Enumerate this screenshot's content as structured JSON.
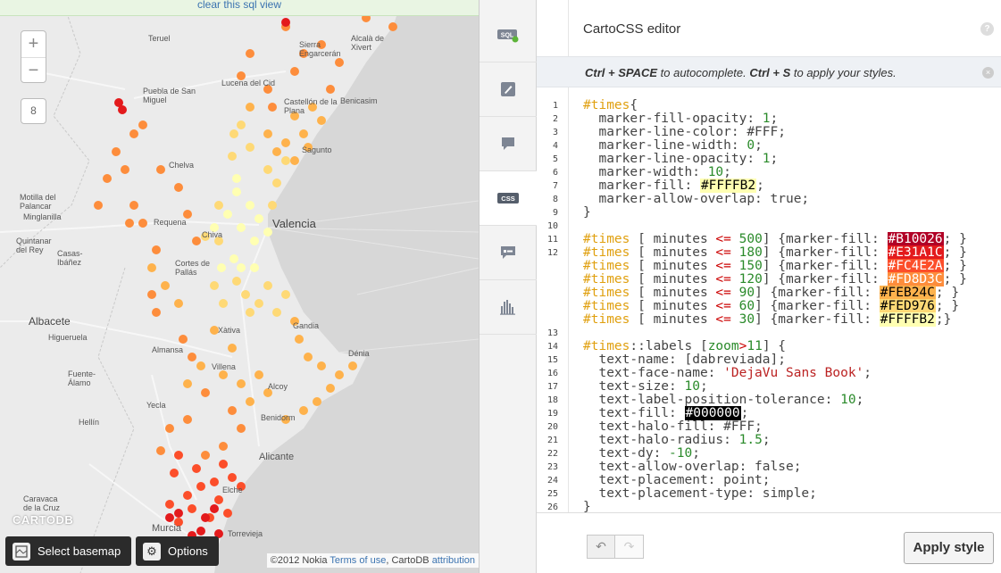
{
  "map": {
    "sql_banner": "clear this sql view",
    "zoom_in": "+",
    "zoom_out": "−",
    "zoom_level": "8",
    "logo": "CARTODB",
    "basemap_button": "Select basemap",
    "options_button": "Options",
    "attribution": {
      "prefix": "©2012 Nokia",
      "terms": "Terms of use",
      "middle": ", CartoDB",
      "link": "attribution"
    },
    "labels": {
      "l1": "Teruel",
      "l2": "Sierra Engarcerán",
      "l3": "Puebla de San Miguel",
      "l4": "Lucena del Cid",
      "l5": "Castellón de la Plana",
      "l6": "Benicasim",
      "l7": "Chelva",
      "l8": "Requena",
      "l9": "Valencia",
      "l10": "Motilla del Palancar",
      "l11": "Minglanilla",
      "l12": "Quintanar del Rey",
      "l13": "Casas-Ibáñez",
      "l14": "Albacete",
      "l15": "Higueruela",
      "l16": "Almansa",
      "l17": "Fuente-Álamo",
      "l18": "Hellín",
      "l19": "Yecla",
      "l20": "Gandia",
      "l21": "Dénia",
      "l22": "Alicante",
      "l23": "Murcia",
      "l24": "Torrevieja",
      "l25": "Caravaca de la Cruz",
      "l26": "Alcalà de Xivert",
      "l27": "Cortes de Pallás",
      "l28": "Alcoy",
      "l29": "Benidorm",
      "l30": "Elche",
      "l31": "Sagunto",
      "l32": "Chiva",
      "l33": "Xàtiva",
      "l34": "Villena"
    }
  },
  "toolbar": {
    "items": [
      {
        "name": "sql-tool",
        "label": "SQL"
      },
      {
        "name": "wizard-tool",
        "label": "wizard"
      },
      {
        "name": "infowindow-tool",
        "label": "infowindow"
      },
      {
        "name": "css-tool",
        "label": "CSS"
      },
      {
        "name": "legend-tool",
        "label": "legend"
      },
      {
        "name": "filters-tool",
        "label": "filters"
      }
    ]
  },
  "editor": {
    "title": "CartoCSS editor",
    "help": "?",
    "hint": {
      "k1": "Ctrl + SPACE",
      "t1": " to autocomplete. ",
      "k2": "Ctrl + S",
      "t2": " to apply your styles."
    },
    "close": "×",
    "undo": "↶",
    "redo": "↷",
    "apply_button": "Apply style",
    "code_lines": [
      {
        "n": "1",
        "tokens": [
          [
            "sel",
            "#times"
          ],
          [
            "",
            "{"
          ]
        ]
      },
      {
        "n": "2",
        "tokens": [
          [
            "",
            "  marker-fill-opacity: "
          ],
          [
            "num",
            "1"
          ],
          [
            "",
            ";"
          ]
        ]
      },
      {
        "n": "3",
        "tokens": [
          [
            "",
            "  marker-line-color: #FFF;"
          ]
        ]
      },
      {
        "n": "4",
        "tokens": [
          [
            "",
            "  marker-line-width: "
          ],
          [
            "num",
            "0"
          ],
          [
            "",
            ";"
          ]
        ]
      },
      {
        "n": "5",
        "tokens": [
          [
            "",
            "  marker-line-opacity: "
          ],
          [
            "num",
            "1"
          ],
          [
            "",
            ";"
          ]
        ]
      },
      {
        "n": "6",
        "tokens": [
          [
            "",
            "  marker-width: "
          ],
          [
            "num",
            "10"
          ],
          [
            "",
            ";"
          ]
        ]
      },
      {
        "n": "7",
        "tokens": [
          [
            "",
            "  marker-fill: "
          ],
          [
            "sw:#FFFFB2:#000",
            "#FFFFB2"
          ],
          [
            "",
            ";"
          ]
        ]
      },
      {
        "n": "8",
        "tokens": [
          [
            "",
            "  marker-allow-overlap: true;"
          ]
        ]
      },
      {
        "n": "9",
        "tokens": [
          [
            "",
            "}"
          ]
        ]
      },
      {
        "n": "10",
        "tokens": []
      },
      {
        "n": "11",
        "tokens": [
          [
            "sel",
            "#times"
          ],
          [
            "",
            " [ minutes "
          ],
          [
            "op",
            "<="
          ],
          [
            "num",
            " 500"
          ],
          [
            "",
            "] {marker-fill: "
          ],
          [
            "sw:#B10026:#fff",
            "#B10026"
          ],
          [
            "",
            "; }"
          ]
        ]
      },
      {
        "n": "12",
        "tokens": [
          [
            "sel",
            "#times"
          ],
          [
            "",
            " [ minutes "
          ],
          [
            "op",
            "<="
          ],
          [
            "num",
            " 180"
          ],
          [
            "",
            "] {marker-fill: "
          ],
          [
            "sw:#E31A1C:#fff",
            "#E31A1C"
          ],
          [
            "",
            "; }"
          ]
        ]
      },
      {
        "n": "",
        "tokens": [
          [
            "sel",
            "#times"
          ],
          [
            "",
            " [ minutes "
          ],
          [
            "op",
            "<="
          ],
          [
            "num",
            " 150"
          ],
          [
            "",
            "] {marker-fill: "
          ],
          [
            "sw:#FC4E2A:#fff",
            "#FC4E2A"
          ],
          [
            "",
            "; }"
          ]
        ]
      },
      {
        "n": "",
        "tokens": [
          [
            "sel",
            "#times"
          ],
          [
            "",
            " [ minutes "
          ],
          [
            "op",
            "<="
          ],
          [
            "num",
            " 120"
          ],
          [
            "",
            "] {marker-fill: "
          ],
          [
            "sw:#FD8D3C:#fff",
            "#FD8D3C"
          ],
          [
            "",
            "; }"
          ]
        ]
      },
      {
        "n": "",
        "tokens": [
          [
            "sel",
            "#times"
          ],
          [
            "",
            " [ minutes "
          ],
          [
            "op",
            "<="
          ],
          [
            "num",
            " 90"
          ],
          [
            "",
            "] {marker-fill: "
          ],
          [
            "sw:#FEB24C:#000",
            "#FEB24C"
          ],
          [
            "",
            "; }"
          ]
        ]
      },
      {
        "n": "",
        "tokens": [
          [
            "sel",
            "#times"
          ],
          [
            "",
            " [ minutes "
          ],
          [
            "op",
            "<="
          ],
          [
            "num",
            " 60"
          ],
          [
            "",
            "] {marker-fill: "
          ],
          [
            "sw:#FED976:#000",
            "#FED976"
          ],
          [
            "",
            "; }"
          ]
        ]
      },
      {
        "n": "",
        "tokens": [
          [
            "sel",
            "#times"
          ],
          [
            "",
            " [ minutes "
          ],
          [
            "op",
            "<="
          ],
          [
            "num",
            " 30"
          ],
          [
            "",
            "] {marker-fill: "
          ],
          [
            "sw:#FFFFB2:#000",
            "#FFFFB2"
          ],
          [
            "",
            ";}"
          ]
        ]
      },
      {
        "n": "13",
        "tokens": []
      },
      {
        "n": "14",
        "tokens": [
          [
            "sel",
            "#times"
          ],
          [
            "",
            "::labels ["
          ],
          [
            "kw",
            "zoom"
          ],
          [
            "op",
            ">"
          ],
          [
            "num",
            "11"
          ],
          [
            "",
            "] {"
          ]
        ]
      },
      {
        "n": "15",
        "tokens": [
          [
            "",
            "  text-name: [dabreviada];"
          ]
        ]
      },
      {
        "n": "16",
        "tokens": [
          [
            "",
            "  text-face-name: "
          ],
          [
            "str",
            "'DejaVu Sans Book'"
          ],
          [
            "",
            ";"
          ]
        ]
      },
      {
        "n": "17",
        "tokens": [
          [
            "",
            "  text-size: "
          ],
          [
            "num",
            "10"
          ],
          [
            "",
            ";"
          ]
        ]
      },
      {
        "n": "18",
        "tokens": [
          [
            "",
            "  text-label-position-tolerance: "
          ],
          [
            "num",
            "10"
          ],
          [
            "",
            ";"
          ]
        ]
      },
      {
        "n": "19",
        "tokens": [
          [
            "",
            "  text-fill: "
          ],
          [
            "sw:#000000:#fff",
            "#000000"
          ],
          [
            "",
            ";"
          ]
        ]
      },
      {
        "n": "20",
        "tokens": [
          [
            "",
            "  text-halo-fill: #FFF;"
          ]
        ]
      },
      {
        "n": "21",
        "tokens": [
          [
            "",
            "  text-halo-radius: "
          ],
          [
            "num",
            "1.5"
          ],
          [
            "",
            ";"
          ]
        ]
      },
      {
        "n": "22",
        "tokens": [
          [
            "",
            "  text-dy: "
          ],
          [
            "num",
            "-10"
          ],
          [
            "",
            ";"
          ]
        ]
      },
      {
        "n": "23",
        "tokens": [
          [
            "",
            "  text-allow-overlap: false;"
          ]
        ]
      },
      {
        "n": "24",
        "tokens": [
          [
            "",
            "  text-placement: point;"
          ]
        ]
      },
      {
        "n": "25",
        "tokens": [
          [
            "",
            "  text-placement-type: simple;"
          ]
        ]
      },
      {
        "n": "26",
        "tokens": [
          [
            "",
            "}"
          ]
        ]
      }
    ]
  }
}
